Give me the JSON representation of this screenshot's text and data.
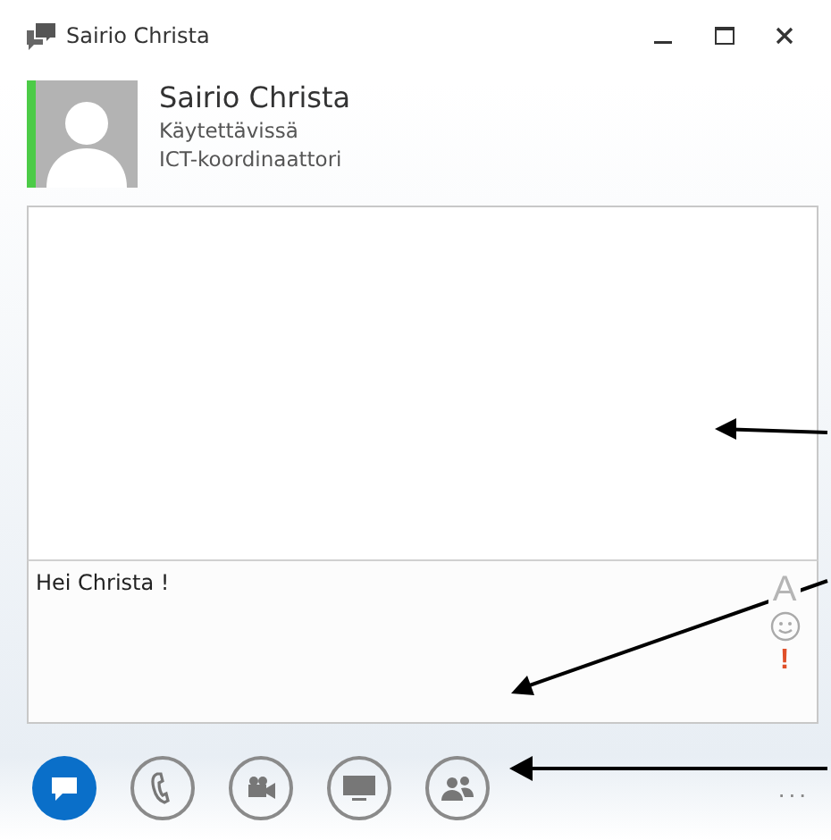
{
  "window": {
    "title": "Sairio Christa"
  },
  "contact": {
    "name": "Sairio Christa",
    "status": "Käytettävissä",
    "job_title": "ICT-koordinaattori"
  },
  "compose": {
    "value": "Hei Christa !",
    "format_glyph": "A",
    "important_glyph": "!"
  },
  "toolbar": [
    {
      "kind": "im",
      "selected": true
    },
    {
      "kind": "call",
      "selected": false
    },
    {
      "kind": "video",
      "selected": false
    },
    {
      "kind": "screen",
      "selected": false
    },
    {
      "kind": "people",
      "selected": false
    }
  ],
  "more": "..."
}
